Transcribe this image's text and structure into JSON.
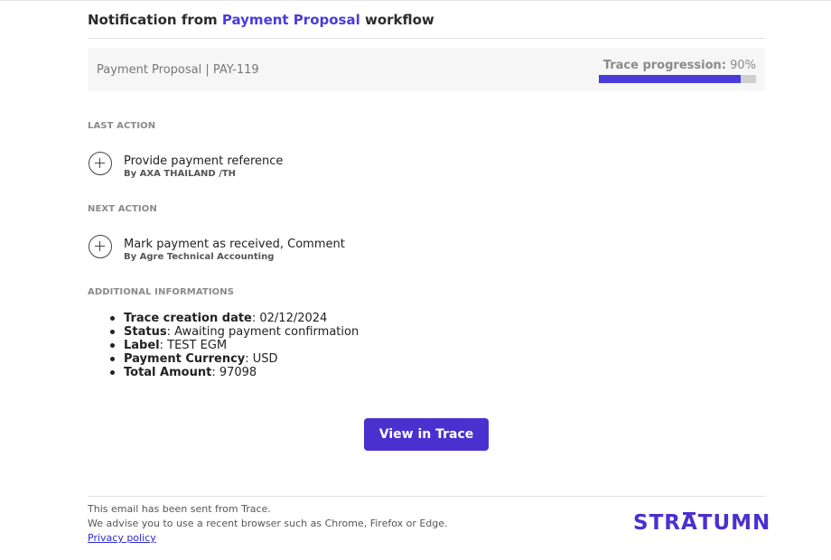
{
  "header": {
    "prefix": "Notification from ",
    "workflow": "Payment Proposal",
    "suffix": " workflow"
  },
  "trace": {
    "reference": "Payment Proposal | PAY-119",
    "progression_label": "Trace progression:",
    "progression_value": "90%",
    "progression_fraction": 0.9
  },
  "last_action": {
    "heading": "LAST ACTION",
    "name": "Provide payment reference",
    "by": "By AXA THAILAND /TH"
  },
  "next_action": {
    "heading": "NEXT ACTION",
    "name": "Mark payment as received, Comment",
    "by": "By Agre Technical Accounting"
  },
  "additional": {
    "heading": "ADDITIONAL INFORMATIONS",
    "items": [
      {
        "key": "Trace creation date",
        "value": ": 02/12/2024"
      },
      {
        "key": "Status",
        "value": ": Awaiting payment confirmation"
      },
      {
        "key": "Label",
        "value": ": TEST EGM"
      },
      {
        "key": "Payment Currency",
        "value": ": USD"
      },
      {
        "key": "Total Amount",
        "value": ": 97098"
      }
    ]
  },
  "cta": {
    "label": "View in Trace"
  },
  "footer": {
    "line1": "This email has been sent from Trace.",
    "line2": "We advise you to use a recent browser such as Chrome, Firefox or Edge.",
    "privacy": "Privacy policy",
    "logo": "STRATUMN"
  },
  "colors": {
    "accent": "#4b30d0",
    "progress_track": "#cfcfcf",
    "panel": "#f6f6f6"
  }
}
